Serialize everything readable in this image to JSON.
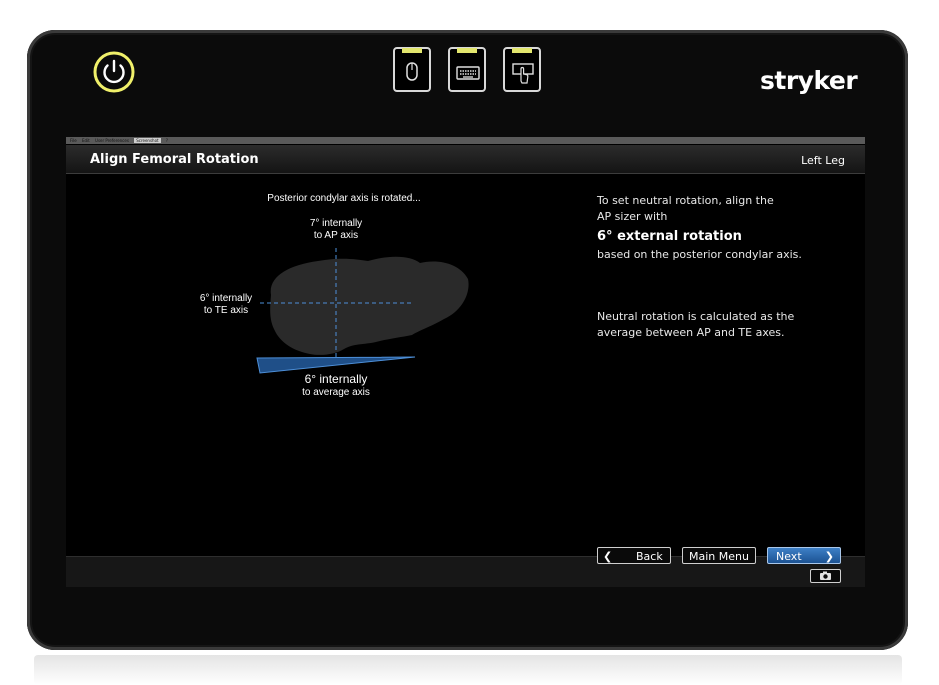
{
  "device": {
    "brand": "stryker"
  },
  "hardware_buttons": [
    {
      "icon": "mouse-icon"
    },
    {
      "icon": "keyboard-icon"
    },
    {
      "icon": "touch-icon"
    }
  ],
  "menubar": {
    "items": [
      "File",
      "Edit",
      "User Preferences",
      "Screenshot",
      "?"
    ]
  },
  "header": {
    "title": "Align Femoral Rotation",
    "side": "Left Leg"
  },
  "diagram": {
    "caption": "Posterior condylar axis is rotated...",
    "ap_line1": "7° internally",
    "ap_line2": "to AP axis",
    "te_line1": "6° internally",
    "te_line2": "to TE axis",
    "avg_line1": "6° internally",
    "avg_line2": "to average axis"
  },
  "instructions": {
    "line1": "To set neutral rotation, align the",
    "line2": "AP sizer with",
    "highlight": "6° external rotation",
    "line3": "based on the posterior condylar axis.",
    "note1": "Neutral rotation is calculated as the",
    "note2": "average between AP and TE axes."
  },
  "footer": {
    "back_label": "Back",
    "main_menu_label": "Main Menu",
    "next_label": "Next"
  },
  "colors": {
    "accent_blue": "#2a6bb5",
    "led_yellow": "#e2e66e",
    "power_ring": "#f0f06a"
  }
}
